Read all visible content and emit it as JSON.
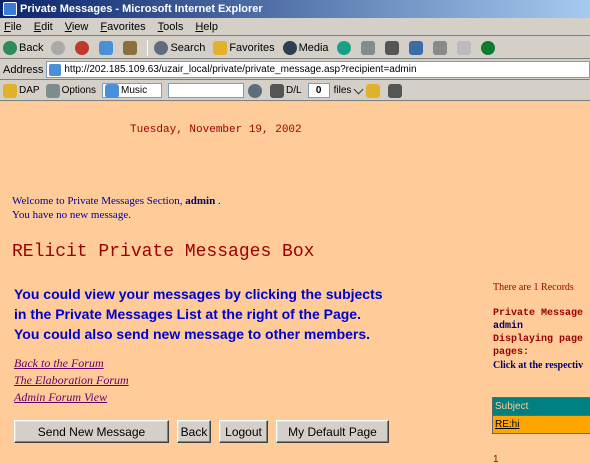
{
  "window": {
    "title": "Private Messages - Microsoft Internet Explorer"
  },
  "menu": [
    "File",
    "Edit",
    "View",
    "Favorites",
    "Tools",
    "Help"
  ],
  "toolbar": {
    "back": "Back",
    "search": "Search",
    "favorites": "Favorites",
    "media": "Media"
  },
  "address": {
    "label": "Address",
    "url": "http://202.185.109.63/uzair_local/private/private_message.asp?recipient=admin"
  },
  "linksbar": {
    "dap": "DAP",
    "options": "Options",
    "music": "Music",
    "dl": "D/L",
    "dl_count": "0",
    "files": "files"
  },
  "page": {
    "date": "Tuesday, November 19, 2002",
    "welcome_prefix": "Welcome to Private Messages Section, ",
    "welcome_user": "admin",
    "welcome_suffix": " .",
    "no_new": "You have no new message.",
    "box_title": "RElicit Private Messages Box",
    "info_line1": "You could view your messages by clicking the subjects",
    "info_line2": "in the Private Messages List at the right of the Page.",
    "info_line3": "You could also send new message to other members.",
    "links": {
      "back_forum": "Back to the Forum",
      "elaboration_forum": "The Elaboration Forum",
      "admin_forum_view": "Admin Forum View"
    },
    "buttons": {
      "send_new": "Send New Message",
      "back": "Back",
      "logout": "Logout",
      "default_page": "My Default Page"
    }
  },
  "panel": {
    "records": "There are 1 Records",
    "pm_label": "Private Message",
    "pm_user": "admin",
    "displaying": "Displaying page",
    "pages": "pages:",
    "click_hint": "Click at the respectiv",
    "table_header": "Subject",
    "row_subject": "RE:hi",
    "pager": "1"
  },
  "colors": {
    "page_bg": "#ffcc99",
    "title_red": "#990000",
    "info_blue": "#0000cc",
    "table_header": "#008080",
    "table_row": "#ffa500"
  }
}
